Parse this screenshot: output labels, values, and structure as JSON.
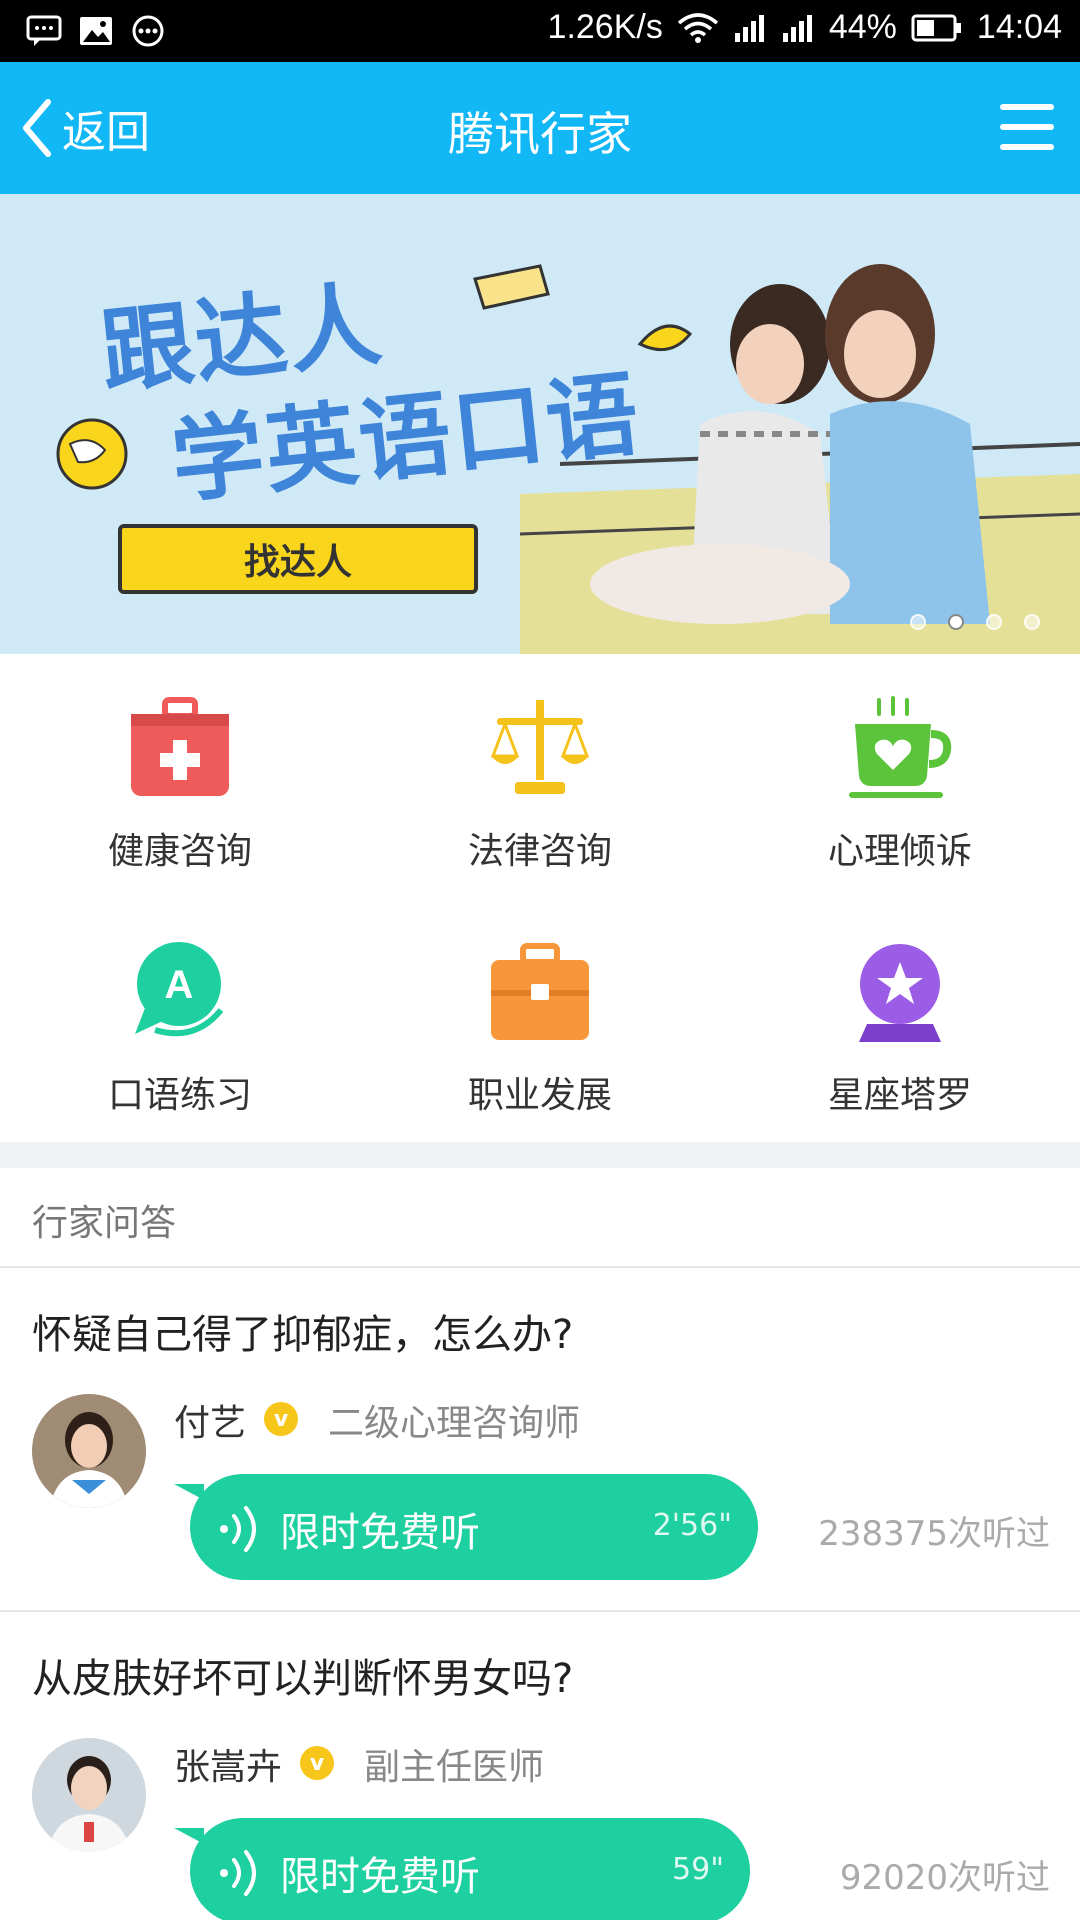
{
  "status_bar": {
    "speed": "1.26K/s",
    "battery": "44%",
    "time": "14:04",
    "icons": [
      "message-icon",
      "image-icon",
      "more-icon",
      "wifi-icon",
      "signal-icon",
      "signal-icon",
      "battery-icon"
    ]
  },
  "nav": {
    "back_label": "返回",
    "title": "腾讯行家"
  },
  "banner": {
    "headline_line1": "跟达人",
    "headline_line2": "学英语口语",
    "cta": "找达人",
    "dots": 4,
    "active_dot": 2
  },
  "categories": [
    {
      "label": "健康咨询",
      "icon": "medical-kit-icon",
      "color": "#ef5b5b"
    },
    {
      "label": "法律咨询",
      "icon": "scales-icon",
      "color": "#f5c21b"
    },
    {
      "label": "心理倾诉",
      "icon": "coffee-heart-icon",
      "color": "#5cc43a"
    },
    {
      "label": "口语练习",
      "icon": "speech-bubble-a-icon",
      "color": "#1ecfa0"
    },
    {
      "label": "职业发展",
      "icon": "briefcase-icon",
      "color": "#f7963a"
    },
    {
      "label": "星座塔罗",
      "icon": "crystal-ball-icon",
      "color": "#9b5de5"
    }
  ],
  "section": {
    "title": "行家问答"
  },
  "qa": [
    {
      "question": "怀疑自己得了抑郁症，怎么办?",
      "name": "付艺",
      "badge": "v",
      "title": "二级心理咨询师",
      "play_label": "限时免费听",
      "duration": "2'56\"",
      "listens": "238375次听过"
    },
    {
      "question": "从皮肤好坏可以判断怀男女吗?",
      "name": "张嵩卉",
      "badge": "v",
      "title": "副主任医师",
      "play_label": "限时免费听",
      "duration": "59\"",
      "listens": "92020次听过"
    }
  ],
  "colors": {
    "nav_bg": "#12b7f5",
    "play_bg": "#1ecfa0",
    "badge": "#f7c61a"
  }
}
